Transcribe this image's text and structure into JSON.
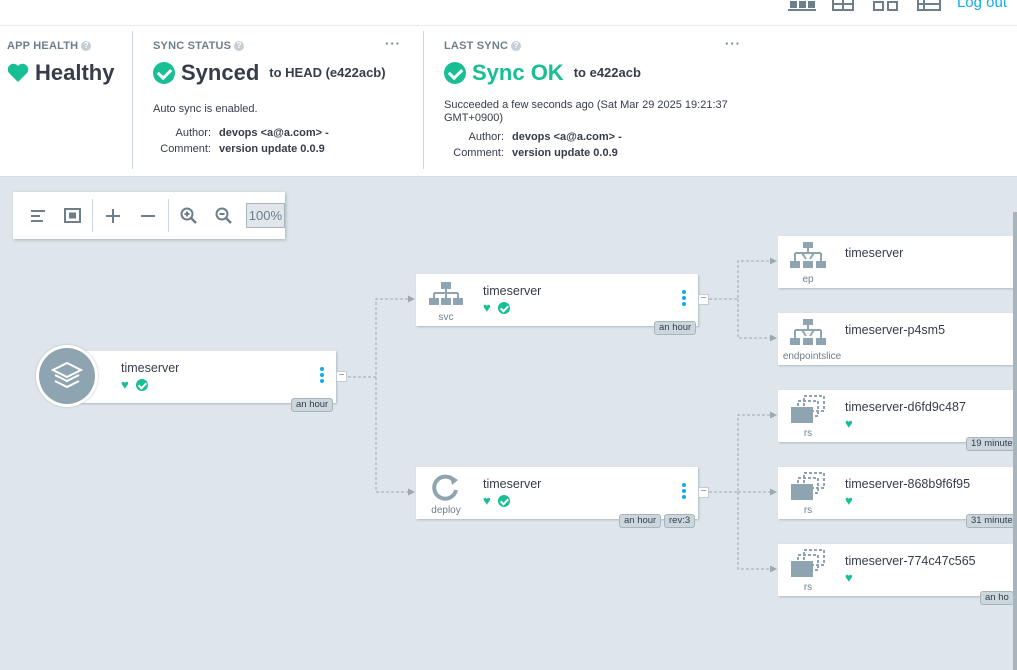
{
  "topbar": {
    "logout_label": "Log out",
    "view_icons": [
      "tree-view-icon",
      "pods-view-icon",
      "network-view-icon",
      "list-view-icon"
    ]
  },
  "app_health": {
    "title": "APP HEALTH",
    "status": "Healthy",
    "color": "#18be94"
  },
  "sync_status": {
    "title": "SYNC STATUS",
    "status": "Synced",
    "target": "to HEAD (e422acb)",
    "auto_sync": "Auto sync is enabled.",
    "author_label": "Author:",
    "author": "devops <a@a.com> -",
    "comment_label": "Comment:",
    "comment": "version update 0.0.9",
    "menu": "···"
  },
  "last_sync": {
    "title": "LAST SYNC",
    "status": "Sync OK",
    "target": "to e422acb",
    "detail_line1": "Succeeded a few seconds ago (Sat Mar 29 2025 19:21:37",
    "detail_line2": "GMT+0900)",
    "author_label": "Author:",
    "author": "devops <a@a.com> -",
    "comment_label": "Comment:",
    "comment": "version update 0.0.9",
    "menu": "···"
  },
  "graph_controls": {
    "zoom": "100%"
  },
  "nodes": {
    "app": {
      "name": "timeserver",
      "age": "an hour"
    },
    "svc": {
      "name": "timeserver",
      "kind": "svc",
      "age": "an hour"
    },
    "deploy": {
      "name": "timeserver",
      "kind": "deploy",
      "age": "an hour",
      "rev": "rev:3"
    },
    "ep": {
      "name": "timeserver",
      "kind": "ep"
    },
    "endpointslice": {
      "name": "timeserver-p4sm5",
      "kind": "endpointslice"
    },
    "rs1": {
      "name": "timeserver-d6fd9c487",
      "kind": "rs",
      "age": "19 minute"
    },
    "rs2": {
      "name": "timeserver-868b9f6f95",
      "kind": "rs",
      "age": "31 minute"
    },
    "rs3": {
      "name": "timeserver-774c47c565",
      "kind": "rs",
      "age": "an ho"
    }
  }
}
